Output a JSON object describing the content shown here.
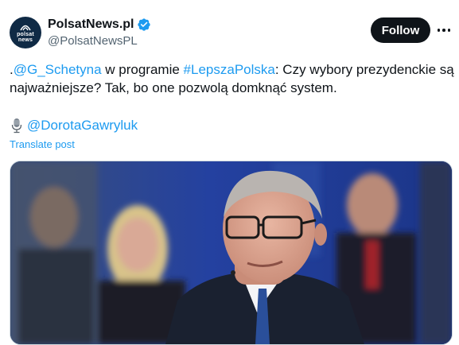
{
  "author": {
    "display_name": "PolsatNews.pl",
    "handle": "@PolsatNewsPL",
    "avatar_text_line1": "polsat",
    "avatar_text_line2": "news",
    "verified": true
  },
  "actions": {
    "follow_label": "Follow",
    "more_icon": "more-horizontal-icon"
  },
  "tweet": {
    "prefix": ".",
    "mention_1": "@G_Schetyna",
    "text_1": " w programie ",
    "hashtag_1": "#LepszaPolska",
    "text_2": ": Czy wybory prezydenckie są najważniejsze? Tak, bo one pozwolą domknąć system.",
    "mic_icon": "microphone-icon",
    "mention_2": "@DorotaGawryluk"
  },
  "translate_label": "Translate post",
  "colors": {
    "link": "#1d9bf0",
    "text": "#0f1419",
    "secondary": "#536471",
    "follow_bg": "#0f1419",
    "verified": "#1d9bf0"
  }
}
